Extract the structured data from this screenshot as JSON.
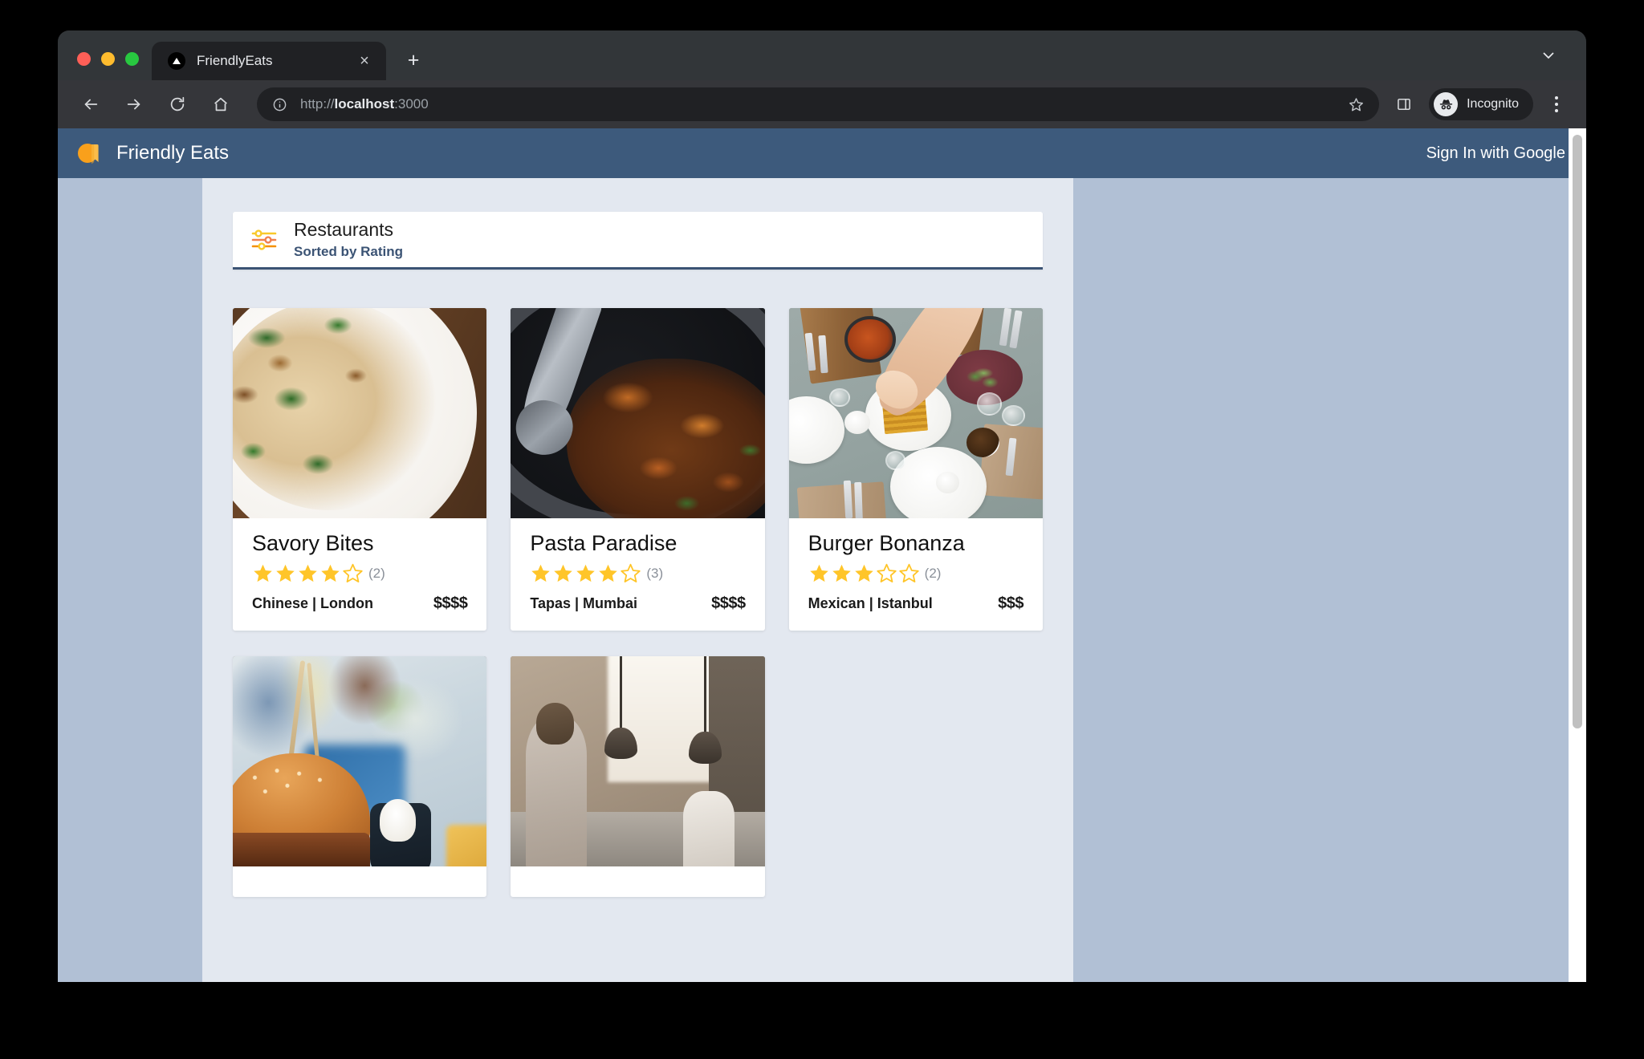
{
  "browser": {
    "window_controls": [
      "close",
      "minimize",
      "maximize"
    ],
    "tab": {
      "title": "FriendlyEats",
      "favicon": "triangle-favicon",
      "close_label": "×"
    },
    "new_tab_label": "+",
    "toolbar": {
      "back_icon": "back-arrow-icon",
      "forward_icon": "forward-arrow-icon",
      "reload_icon": "reload-icon",
      "home_icon": "home-icon",
      "info_icon": "info-icon",
      "url_scheme": "http://",
      "url_host": "localhost",
      "url_rest": ":3000",
      "star_icon": "bookmark-star-icon",
      "side_panel_icon": "side-panel-icon",
      "profile_label": "Incognito",
      "profile_icon": "incognito-icon",
      "menu_icon": "three-dot-menu-icon"
    }
  },
  "app": {
    "brand": "Friendly Eats",
    "logo_icon": "friendly-eats-logo",
    "sign_in_label": "Sign In with Google",
    "header_color": "#3d5a7c",
    "page_background": "#b1c0d5",
    "content_background": "#e3e8f0"
  },
  "filter_bar": {
    "icon": "filter-sliders-icon",
    "title": "Restaurants",
    "subtitle": "Sorted by Rating",
    "accent_color": "#3b5374"
  },
  "restaurants": [
    {
      "name": "Savory Bites",
      "rating": 4,
      "max_rating": 5,
      "review_count": "(2)",
      "category": "Chinese",
      "city": "London",
      "meta": "Chinese | London",
      "price": "$$$$",
      "photo": "pasta-with-greens"
    },
    {
      "name": "Pasta Paradise",
      "rating": 4,
      "max_rating": 5,
      "review_count": "(3)",
      "category": "Tapas",
      "city": "Mumbai",
      "meta": "Tapas | Mumbai",
      "price": "$$$$",
      "photo": "braised-meat-in-pot"
    },
    {
      "name": "Burger Bonanza",
      "rating": 3,
      "max_rating": 5,
      "review_count": "(2)",
      "category": "Mexican",
      "city": "Istanbul",
      "meta": "Mexican | Istanbul",
      "price": "$$$",
      "photo": "brunch-table-overhead"
    },
    {
      "name": "",
      "rating": 0,
      "max_rating": 5,
      "review_count": "",
      "category": "",
      "city": "",
      "meta": "",
      "price": "",
      "photo": "burger-closeup"
    },
    {
      "name": "",
      "rating": 0,
      "max_rating": 5,
      "review_count": "",
      "category": "",
      "city": "",
      "meta": "",
      "price": "",
      "photo": "restaurant-interior"
    }
  ],
  "star_colors": {
    "filled": "#ffc529",
    "empty_stroke": "#ffc529"
  },
  "scrollbar": {
    "thumb_color": "#c0c0c0",
    "track_color": "#ffffff"
  }
}
